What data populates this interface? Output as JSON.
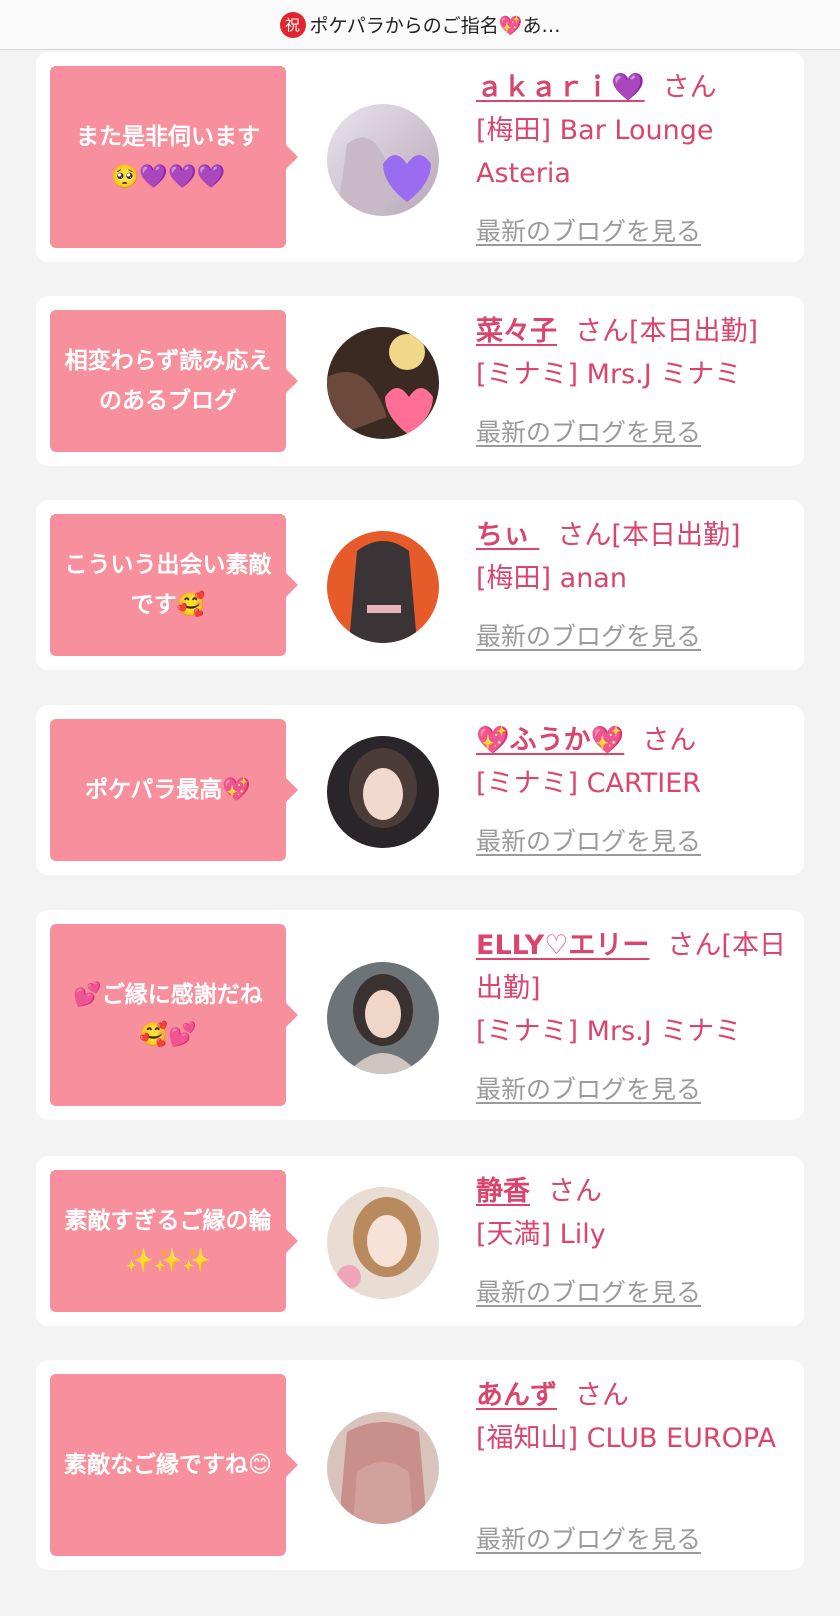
{
  "header": {
    "badge": "祝",
    "title": "ポケパラからのご指名💖あ…"
  },
  "blog_link_label": "最新のブログを見る",
  "entries": [
    {
      "message": "また是非伺います🥺💜💜💜",
      "name": "ａｋａｒｉ💜",
      "honorific": "さん",
      "shop": "[梅田] Bar Lounge Asteria"
    },
    {
      "message": "相変わらず読み応えのあるブログ",
      "name": "菜々子",
      "honorific": "さん[本日出勤]",
      "shop": "[ミナミ] Mrs.J ミナミ"
    },
    {
      "message": "こういう出会い素敵です🥰",
      "name": "ちぃ ",
      "honorific": "さん[本日出勤]",
      "shop": "[梅田] anan"
    },
    {
      "message": "ポケパラ最高💖",
      "name": "💖ふうか💖",
      "honorific": "さん",
      "shop": "[ミナミ] CARTIER"
    },
    {
      "message": "💕ご縁に感謝だね🥰💕",
      "name": "ELLY♡エリー",
      "honorific": "さん[本日出勤]",
      "shop": "[ミナミ] Mrs.J ミナミ"
    },
    {
      "message": "素敵すぎるご縁の輪✨✨✨",
      "name": "静香",
      "honorific": "さん",
      "shop": "[天満] Lily"
    },
    {
      "message": "素敵なご縁ですね😊",
      "name": "あんず",
      "honorific": "さん",
      "shop": "[福知山] CLUB EUROPA"
    }
  ]
}
